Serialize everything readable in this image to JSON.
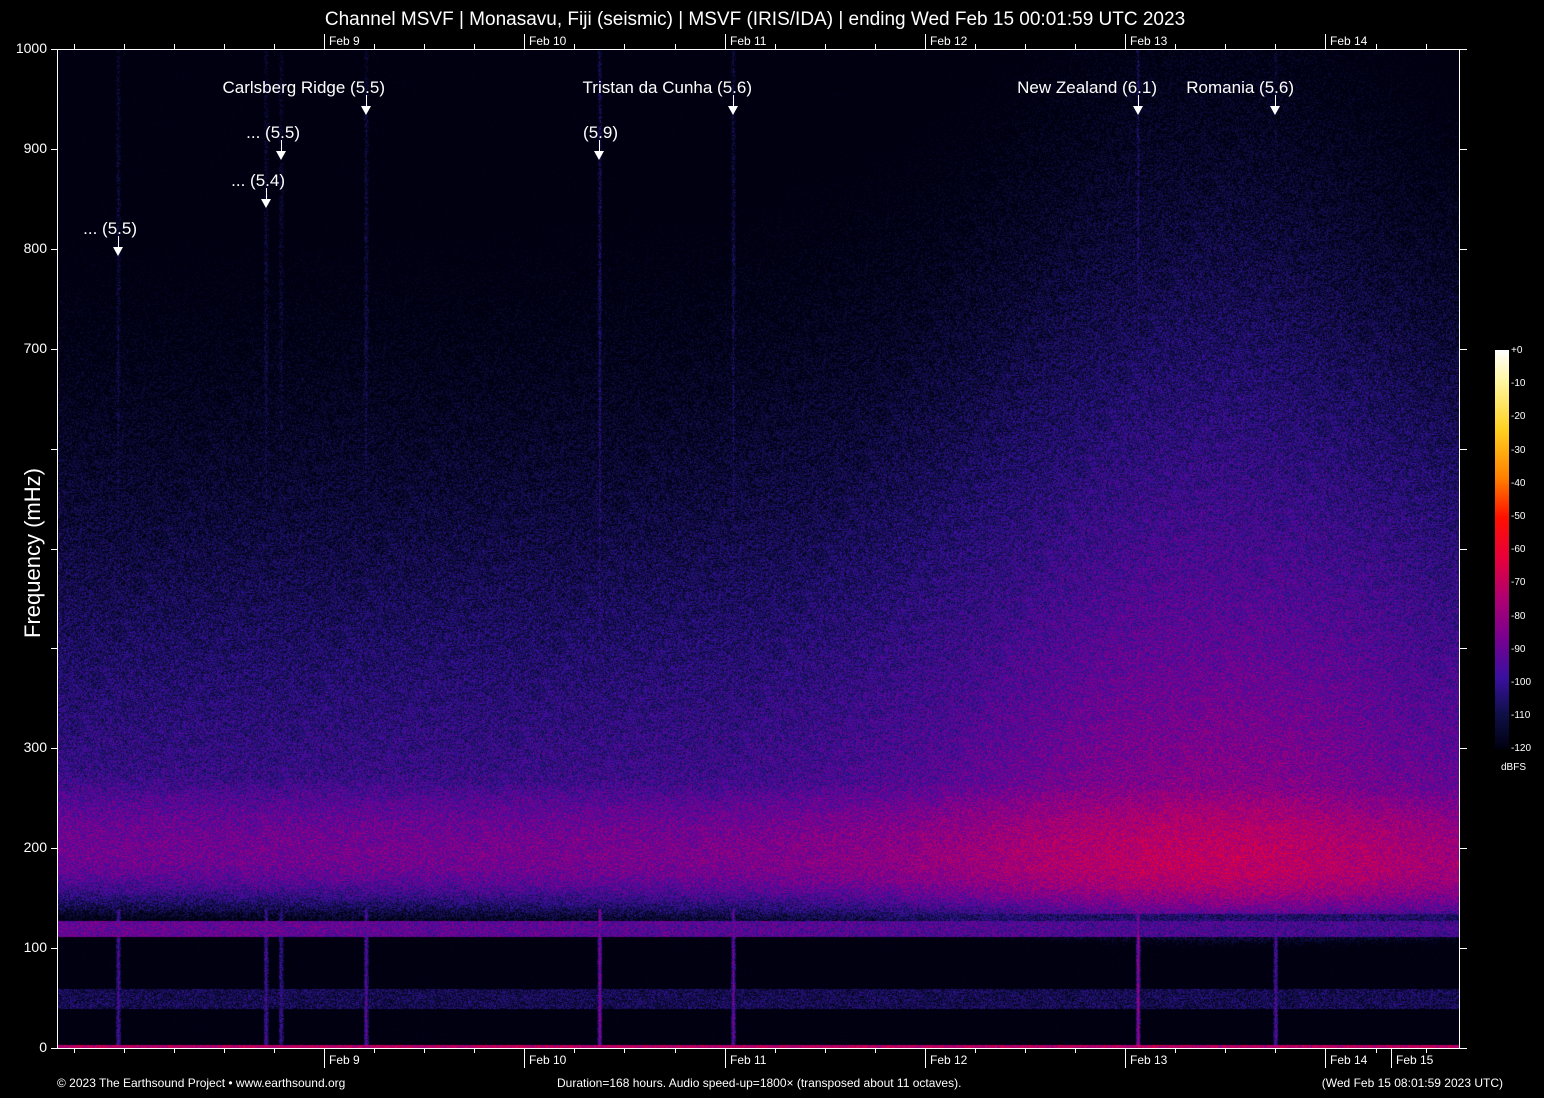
{
  "title": "Channel MSVF | Monasavu, Fiji (seismic) | MSVF (IRIS/IDA) | ending Wed Feb 15 00:01:59 UTC 2023",
  "footer": {
    "copyright": "© 2023 The Earthsound Project • www.earthsound.org",
    "duration": "Duration=168 hours. Audio speed-up=1800× (transposed about 11 octaves).",
    "timestamp": "(Wed Feb 15 08:01:59 2023 UTC)"
  },
  "chart_data": {
    "type": "heatmap",
    "title": "Channel MSVF | Monasavu, Fiji (seismic) | MSVF (IRIS/IDA) | ending Wed Feb 15 00:01:59 UTC 2023",
    "ylabel": "Frequency (mHz)",
    "xlabel": "",
    "ylim": [
      0,
      1000
    ],
    "xlim_hours": [
      0,
      168
    ],
    "y_ticks": [
      {
        "value": 0,
        "label": "0"
      },
      {
        "value": 100,
        "label": "100"
      },
      {
        "value": 200,
        "label": "200"
      },
      {
        "value": 300,
        "label": "300"
      },
      {
        "value": 400,
        "label": ""
      },
      {
        "value": 500,
        "label": ""
      },
      {
        "value": 600,
        "label": ""
      },
      {
        "value": 700,
        "label": "700"
      },
      {
        "value": 800,
        "label": "800"
      },
      {
        "value": 900,
        "label": "900"
      },
      {
        "value": 1000,
        "label": "1000"
      }
    ],
    "x_ticks": [
      {
        "hour": 32,
        "label": "Feb  9"
      },
      {
        "hour": 56,
        "label": "Feb 10"
      },
      {
        "hour": 80,
        "label": "Feb 11"
      },
      {
        "hour": 104,
        "label": "Feb 12"
      },
      {
        "hour": 128,
        "label": "Feb 13"
      },
      {
        "hour": 152,
        "label": "Feb 14"
      },
      {
        "hour": 176,
        "label": "Feb 15"
      }
    ],
    "minor_tick_hours": 6,
    "events": [
      {
        "label": "... (5.5)",
        "hour": 7.3,
        "level": 3,
        "strength": 0.5
      },
      {
        "label": "... (5.4)",
        "hour": 25,
        "level": 2,
        "strength": 0.5
      },
      {
        "label": "... (5.5)",
        "hour": 26.8,
        "level": 1,
        "strength": 0.4
      },
      {
        "label": "Carlsberg Ridge (5.5)",
        "hour": 37,
        "level": 0,
        "strength": 0.6
      },
      {
        "label": "(5.9)",
        "hour": 65,
        "level": 1,
        "strength": 0.9
      },
      {
        "label": "Tristan da Cunha (5.6)",
        "hour": 81,
        "level": 0,
        "strength": 0.7
      },
      {
        "label": "New Zealand (6.1)",
        "hour": 129.5,
        "level": 0,
        "strength": 1.0
      },
      {
        "label": "Romania (5.6)",
        "hour": 146,
        "level": 0,
        "strength": 0.6
      }
    ],
    "colorbar": {
      "unit": "dBFS",
      "range": [
        -120,
        0
      ],
      "ticks": [
        "+0",
        "-10",
        "-20",
        "-30",
        "-40",
        "-50",
        "-60",
        "-70",
        "-80",
        "-90",
        "-100",
        "-110",
        "-120"
      ],
      "colors": [
        "#000010",
        "#10104a",
        "#3a10a0",
        "#7a0090",
        "#b00070",
        "#e8003a",
        "#ff1000",
        "#ff8000",
        "#ffd020",
        "#fff6a0",
        "#ffffff"
      ]
    },
    "microseism_band_mHz": [
      130,
      280
    ]
  }
}
